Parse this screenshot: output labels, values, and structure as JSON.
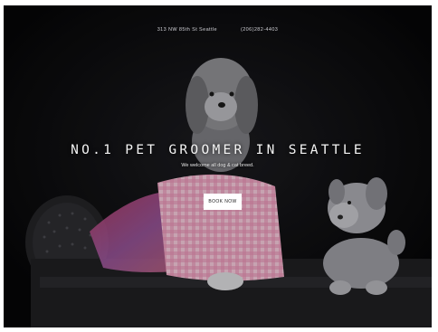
{
  "topbar": {
    "address": "313 NW 85th St Seattle",
    "phone": "(206)282-4403"
  },
  "hero": {
    "headline": "NO.1 PET GROOMER IN SEATTLE",
    "subline": "We welcome all dog & cat breed.",
    "cta_label": "BOOK NOW"
  },
  "colors": {
    "background": "#0d0d0f",
    "cta_background": "#ffffff",
    "headline_text": "#f4f4f4"
  }
}
